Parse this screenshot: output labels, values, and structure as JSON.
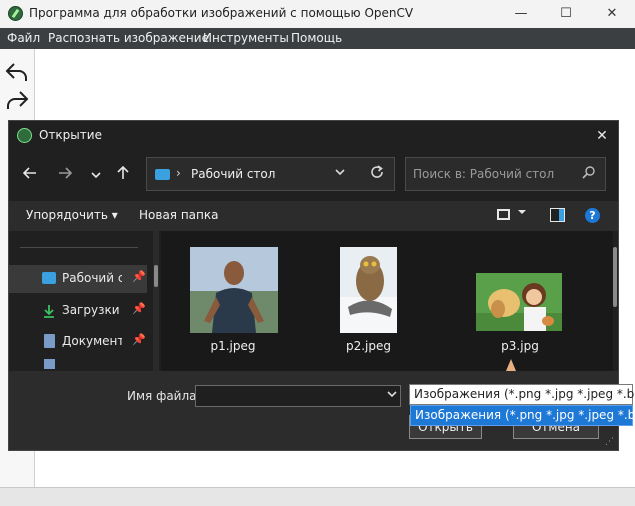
{
  "app": {
    "title": "Программа для обработки изображений с помощью OpenCV",
    "window_controls": [
      "—",
      "☐",
      "✕"
    ]
  },
  "menu": [
    "Файл",
    "Распознать изображение",
    "Инструменты",
    "Помощь"
  ],
  "dialog": {
    "title": "Открытие",
    "close": "✕",
    "address": {
      "separator": "›",
      "location": "Рабочий стол"
    },
    "search_placeholder": "Поиск в: Рабочий стол",
    "toolbar": {
      "organize": "Упорядочить ▾",
      "new_folder": "Новая папка",
      "help": "?"
    },
    "nav_items": [
      {
        "label": "Рабочий стол",
        "icon": "desktop-icon",
        "color": "#3aa0e0",
        "selected": true
      },
      {
        "label": "Загрузки",
        "icon": "download-icon",
        "color": "#3ac060",
        "selected": false
      },
      {
        "label": "Документы",
        "icon": "document-icon",
        "color": "#7a9ac8",
        "selected": false
      }
    ],
    "files": [
      {
        "name": "p1.jpeg",
        "thumb": "photo-man"
      },
      {
        "name": "p2.jpeg",
        "thumb": "photo-owl"
      },
      {
        "name": "p3.jpg",
        "thumb": "photo-girl-dog"
      }
    ],
    "filename_label": "Имя файла:",
    "filename_value": "",
    "buttons": {
      "open": "Открыть",
      "cancel": "Отмена"
    },
    "filetype": {
      "selected": "Изображения (*.png *.jpg *.jpeg *.bmp)",
      "options": [
        "Изображения (*.png *.jpg *.jpeg *.bmp)"
      ]
    }
  },
  "colors": {
    "accent": "#1e78d6",
    "dialog_bg": "#202020",
    "menubar": "#3c3f41"
  }
}
